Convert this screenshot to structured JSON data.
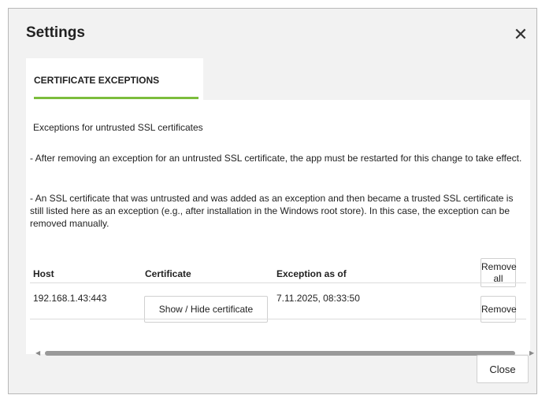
{
  "dialog": {
    "title": "Settings",
    "close_icon": "close-icon"
  },
  "tabs": [
    {
      "label": "CERTIFICATE EXCEPTIONS",
      "active": true
    }
  ],
  "content": {
    "heading": "Exceptions for untrusted SSL certificates",
    "paragraph1": "- After removing an exception for an untrusted SSL certificate, the app must be restarted for this change to take effect.",
    "paragraph2": "- An SSL certificate that was untrusted and was added as an exception and then became a trusted SSL certificate is still listed here as an exception (e.g., after installation in the Windows root store). In this case, the exception can be removed manually."
  },
  "table": {
    "columns": [
      "Host",
      "Certificate",
      "Exception as of"
    ],
    "remove_all_label": "Remove\nall",
    "rows": [
      {
        "host": "192.168.1.43:443",
        "certificate_button": "Show / Hide certificate",
        "exception_as_of": "7.11.2025, 08:33:50",
        "remove_label": "Remove"
      }
    ]
  },
  "footer": {
    "close_label": "Close"
  },
  "colors": {
    "accent": "#7cbd3c",
    "dialog_bg": "#f2f2f2",
    "panel_bg": "#ffffff"
  }
}
